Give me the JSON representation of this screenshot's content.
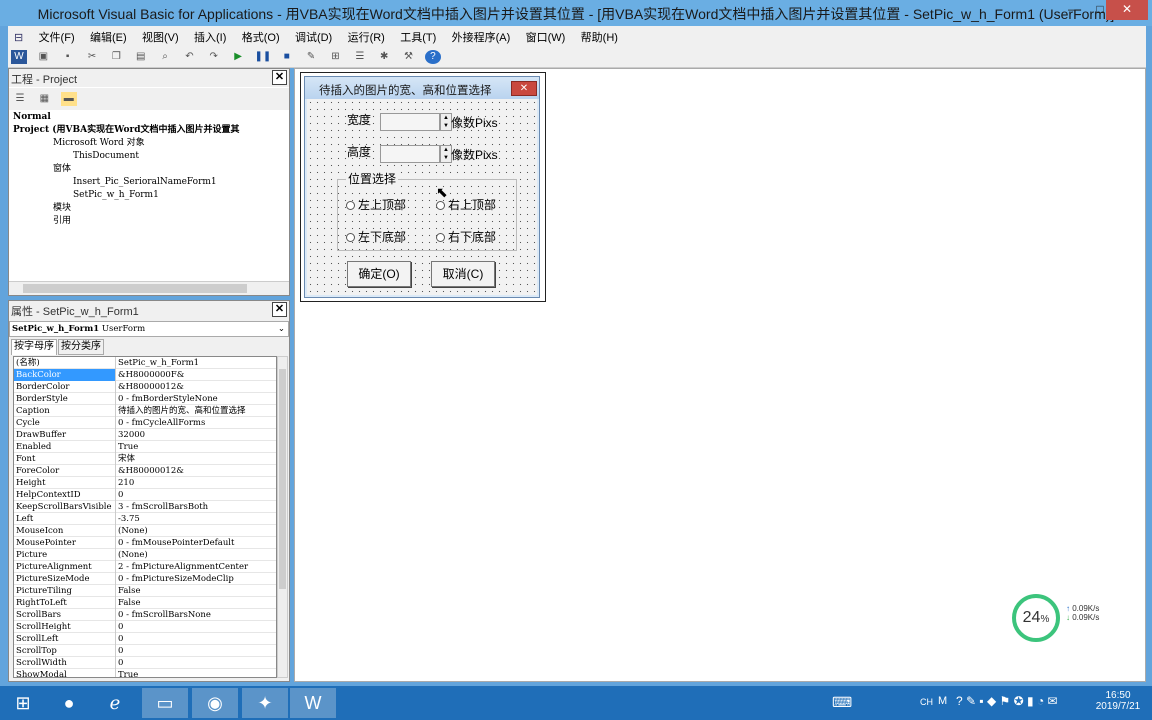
{
  "window": {
    "title": "Microsoft Visual Basic for Applications - 用VBA实现在Word文档中插入图片并设置其位置 - [用VBA实现在Word文档中插入图片并设置其位置 - SetPic_w_h_Form1 (UserForm)]",
    "minimize": "—",
    "maximize": "□",
    "close": "✕"
  },
  "menu": [
    "文件(F)",
    "编辑(E)",
    "视图(V)",
    "插入(I)",
    "格式(O)",
    "调试(D)",
    "运行(R)",
    "工具(T)",
    "外接程序(A)",
    "窗口(W)",
    "帮助(H)"
  ],
  "project": {
    "title": "工程 - Project",
    "tree": [
      "Normal",
      "Project (用VBA实现在Word文档中插入图片并设置其",
      "Microsoft Word 对象",
      "ThisDocument",
      "窗体",
      "Insert_Pic_SerioralNameForm1",
      "SetPic_w_h_Form1",
      "模块",
      "引用"
    ]
  },
  "properties": {
    "title": "属性 - SetPic_w_h_Form1",
    "object_name": "SetPic_w_h_Form1",
    "object_type": "UserForm",
    "tabs": [
      "按字母序",
      "按分类序"
    ],
    "rows": [
      {
        "name": "(名称)",
        "value": "SetPic_w_h_Form1"
      },
      {
        "name": "BackColor",
        "value": "&H8000000F&"
      },
      {
        "name": "BorderColor",
        "value": "&H80000012&"
      },
      {
        "name": "BorderStyle",
        "value": "0 - fmBorderStyleNone"
      },
      {
        "name": "Caption",
        "value": "待插入的图片的宽、高和位置选择"
      },
      {
        "name": "Cycle",
        "value": "0 - fmCycleAllForms"
      },
      {
        "name": "DrawBuffer",
        "value": "32000"
      },
      {
        "name": "Enabled",
        "value": "True"
      },
      {
        "name": "Font",
        "value": "宋体"
      },
      {
        "name": "ForeColor",
        "value": "&H80000012&"
      },
      {
        "name": "Height",
        "value": "210"
      },
      {
        "name": "HelpContextID",
        "value": "0"
      },
      {
        "name": "KeepScrollBarsVisible",
        "value": "3 - fmScrollBarsBoth"
      },
      {
        "name": "Left",
        "value": "-3.75"
      },
      {
        "name": "MouseIcon",
        "value": "(None)"
      },
      {
        "name": "MousePointer",
        "value": "0 - fmMousePointerDefault"
      },
      {
        "name": "Picture",
        "value": "(None)"
      },
      {
        "name": "PictureAlignment",
        "value": "2 - fmPictureAlignmentCenter"
      },
      {
        "name": "PictureSizeMode",
        "value": "0 - fmPictureSizeModeClip"
      },
      {
        "name": "PictureTiling",
        "value": "False"
      },
      {
        "name": "RightToLeft",
        "value": "False"
      },
      {
        "name": "ScrollBars",
        "value": "0 - fmScrollBarsNone"
      },
      {
        "name": "ScrollHeight",
        "value": "0"
      },
      {
        "name": "ScrollLeft",
        "value": "0"
      },
      {
        "name": "ScrollTop",
        "value": "0"
      },
      {
        "name": "ScrollWidth",
        "value": "0"
      },
      {
        "name": "ShowModal",
        "value": "True"
      }
    ]
  },
  "form": {
    "caption": "待插入的图片的宽、高和位置选择",
    "width_label": "宽度",
    "height_label": "高度",
    "unit": "像数Pixs",
    "frame_label": "位置选择",
    "options": [
      "左上顶部",
      "右上顶部",
      "左下底部",
      "右下底部"
    ],
    "ok": "确定(O)",
    "cancel": "取消(C)"
  },
  "meter": {
    "percent": "24",
    "unit": "%",
    "up": "0.09K/s",
    "down": "0.09K/s"
  },
  "clock": {
    "time": "16:50",
    "date": "2019/7/21"
  },
  "tray": {
    "lang": "CH",
    "ime": "M"
  }
}
